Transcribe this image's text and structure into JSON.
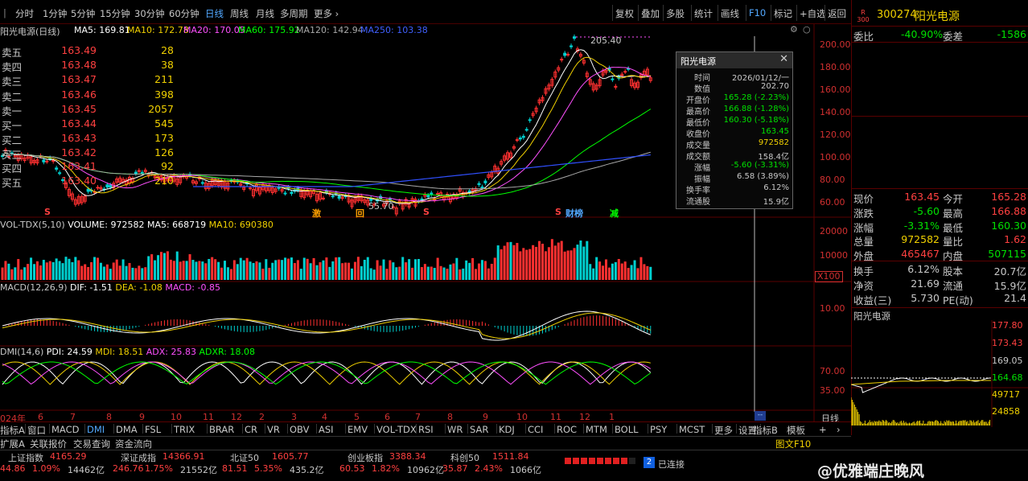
{
  "toolbar": {
    "periods": [
      "分时",
      "1分钟",
      "5分钟",
      "15分钟",
      "30分钟",
      "60分钟",
      "日线",
      "周线",
      "月线",
      "多周期",
      "更多"
    ],
    "right_buttons": [
      "复权",
      "叠加",
      "多股",
      "统计",
      "画线",
      "F10",
      "标记",
      "+自选",
      "返回"
    ]
  },
  "kline": {
    "title": "阳光电源(日线)",
    "ma": [
      {
        "label": "MA5: 169.81",
        "color": "#ffffff"
      },
      {
        "label": "MA10: 172.78",
        "color": "#f0d000"
      },
      {
        "label": "MA20: 170.05",
        "color": "#ff50ff"
      },
      {
        "label": "MA60: 175.92",
        "color": "#00ff00"
      },
      {
        "label": "MA120: 142.94",
        "color": "#a8a8a8"
      },
      {
        "label": "MA250: 103.38",
        "color": "#4060ff"
      }
    ],
    "yticks": [
      "200.00",
      "180.00",
      "160.00",
      "140.00",
      "120.00",
      "100.00",
      "80.00",
      "60.00"
    ],
    "high_label": "205.40",
    "low_label": "55.70",
    "markers": [
      {
        "t": "S",
        "c": "#ff4040"
      },
      {
        "t": "激",
        "c": "#ffa000"
      },
      {
        "t": "回",
        "c": "#ffa000"
      },
      {
        "t": "S",
        "c": "#ff4040"
      },
      {
        "t": "S",
        "c": "#ff4040"
      },
      {
        "t": "财榜",
        "c": "#52a8ff"
      },
      {
        "t": "减",
        "c": "#00ff00"
      }
    ]
  },
  "tooltip": {
    "title": "阳光电源",
    "rows": [
      {
        "k": "时间",
        "v": "2026/01/12/一",
        "c": "#c8c8c8"
      },
      {
        "k": "数值",
        "v": "202.70",
        "c": "#c8c8c8"
      },
      {
        "k": "开盘价",
        "v": "165.28 (-2.23%)",
        "c": "#00e000"
      },
      {
        "k": "最高价",
        "v": "166.88 (-1.28%)",
        "c": "#00e000"
      },
      {
        "k": "最低价",
        "v": "160.30 (-5.18%)",
        "c": "#00e000"
      },
      {
        "k": "收盘价",
        "v": "163.45",
        "c": "#00e000"
      },
      {
        "k": "成交量",
        "v": "972582",
        "c": "#f0d000"
      },
      {
        "k": "成交额",
        "v": "158.4亿",
        "c": "#c8c8c8"
      },
      {
        "k": "涨幅",
        "v": "-5.60 (-3.31%)",
        "c": "#00e000"
      },
      {
        "k": "振幅",
        "v": "6.58 (3.89%)",
        "c": "#c8c8c8"
      },
      {
        "k": "换手率",
        "v": "6.12%",
        "c": "#c8c8c8"
      },
      {
        "k": "流通股",
        "v": "15.9亿",
        "c": "#c8c8c8"
      }
    ]
  },
  "vol": {
    "title": "VOL-TDX(5,10)",
    "volume": "VOLUME: 972582",
    "ma5": "MA5: 668719",
    "ma10": "MA10: 690380",
    "yticks": [
      "20000",
      "10000"
    ],
    "unit": "X100"
  },
  "macd": {
    "title": "MACD(12,26,9)",
    "dif": "DIF: -1.51",
    "dea": "DEA: -1.08",
    "macd": "MACD: -0.85",
    "ytick": "10.00"
  },
  "dmi": {
    "title": "DMI(14,6)",
    "pdi": "PDI: 24.59",
    "mdi": "MDI: 18.51",
    "adx": "ADX: 25.83",
    "adxr": "ADXR: 18.08",
    "yticks": [
      "70.00",
      "35.00"
    ]
  },
  "xaxis": [
    "024年",
    "6",
    "7",
    "8",
    "9",
    "10",
    "11",
    "12",
    "2",
    "3",
    "4",
    "5",
    "6",
    "7",
    "8",
    "9",
    "10",
    "11",
    "12",
    "1"
  ],
  "period_label": "日线",
  "indicator_tabs": [
    "指标A",
    "窗口",
    "MACD",
    "DMI",
    "DMA",
    "FSL",
    "TRIX",
    "BRAR",
    "CR",
    "VR",
    "OBV",
    "ASI",
    "EMV",
    "VOL-TDX",
    "RSI",
    "WR",
    "SAR",
    "KDJ",
    "CCI",
    "ROC",
    "MTM",
    "BOLL",
    "PSY",
    "MCST",
    "更多",
    "设置"
  ],
  "indicator_right": [
    "指标B",
    "模板"
  ],
  "bottom_tabs": [
    "扩展A",
    "关联报价",
    "交易查询",
    "资金流向"
  ],
  "bottom_right": "图文F10",
  "quote": {
    "code": "300274",
    "name": "阳光电源",
    "badge_top": "R",
    "badge_bot": "300",
    "weibi_label": "委比",
    "weibi": "-40.90%",
    "weicha_label": "委差",
    "weicha": "-1586",
    "sells": [
      {
        "n": "卖五",
        "p": "163.49",
        "q": "28"
      },
      {
        "n": "卖四",
        "p": "163.48",
        "q": "38"
      },
      {
        "n": "卖三",
        "p": "163.47",
        "q": "211"
      },
      {
        "n": "卖二",
        "p": "163.46",
        "q": "398"
      },
      {
        "n": "卖一",
        "p": "163.45",
        "q": "2057"
      }
    ],
    "buys": [
      {
        "n": "买一",
        "p": "163.44",
        "q": "545"
      },
      {
        "n": "买二",
        "p": "163.43",
        "q": "173"
      },
      {
        "n": "买三",
        "p": "163.42",
        "q": "126"
      },
      {
        "n": "买四",
        "p": "163.41",
        "q": "92"
      },
      {
        "n": "买五",
        "p": "163.40",
        "q": "210"
      }
    ],
    "stats": [
      {
        "a": "现价",
        "av": "163.45",
        "ac": "#ff4040",
        "b": "今开",
        "bv": "165.28",
        "bc": "#ff4040"
      },
      {
        "a": "涨跌",
        "av": "-5.60",
        "ac": "#00e000",
        "b": "最高",
        "bv": "166.88",
        "bc": "#ff4040"
      },
      {
        "a": "涨幅",
        "av": "-3.31%",
        "ac": "#00e000",
        "b": "最低",
        "bv": "160.30",
        "bc": "#00e000"
      },
      {
        "a": "总量",
        "av": "972582",
        "ac": "#f0d000",
        "b": "量比",
        "bv": "1.62",
        "bc": "#ff4040"
      },
      {
        "a": "外盘",
        "av": "465467",
        "ac": "#ff4040",
        "b": "内盘",
        "bv": "507115",
        "bc": "#00e000"
      }
    ],
    "stats2": [
      {
        "a": "换手",
        "av": "6.12%",
        "b": "股本",
        "bv": "20.7亿"
      },
      {
        "a": "净资",
        "av": "21.69",
        "b": "流通",
        "bv": "15.9亿"
      },
      {
        "a": "收益(三)",
        "av": "5.730",
        "b": "PE(动)",
        "bv": "21.4"
      }
    ],
    "mini_title": "阳光电源",
    "mini_yticks": [
      "177.80",
      "173.43",
      "169.05",
      "164.68"
    ],
    "mini_vticks": [
      "49717",
      "24858"
    ]
  },
  "status": [
    {
      "name": "上证指数",
      "v": "4165.29",
      "c": "#ff4040",
      "ch": "44.86",
      "pct": "1.09%",
      "amt": "14462亿"
    },
    {
      "name": "深证成指",
      "v": "14366.91",
      "c": "#ff4040",
      "ch": "246.76",
      "pct": "1.75%",
      "amt": "21552亿"
    },
    {
      "name": "北证50",
      "v": "1605.77",
      "c": "#ff4040",
      "ch": "81.51",
      "pct": "5.35%",
      "amt": "435.2亿"
    },
    {
      "name": "创业板指",
      "v": "3388.34",
      "c": "#ff4040",
      "ch": "60.53",
      "pct": "1.82%",
      "amt": "10962亿"
    },
    {
      "name": "科创50",
      "v": "1511.84",
      "c": "#ff4040",
      "ch": "35.87",
      "pct": "2.43%",
      "amt": "1066亿"
    }
  ],
  "conn": {
    "num": "2",
    "text": "已连接"
  },
  "watermark": "@优雅端庄晚风"
}
